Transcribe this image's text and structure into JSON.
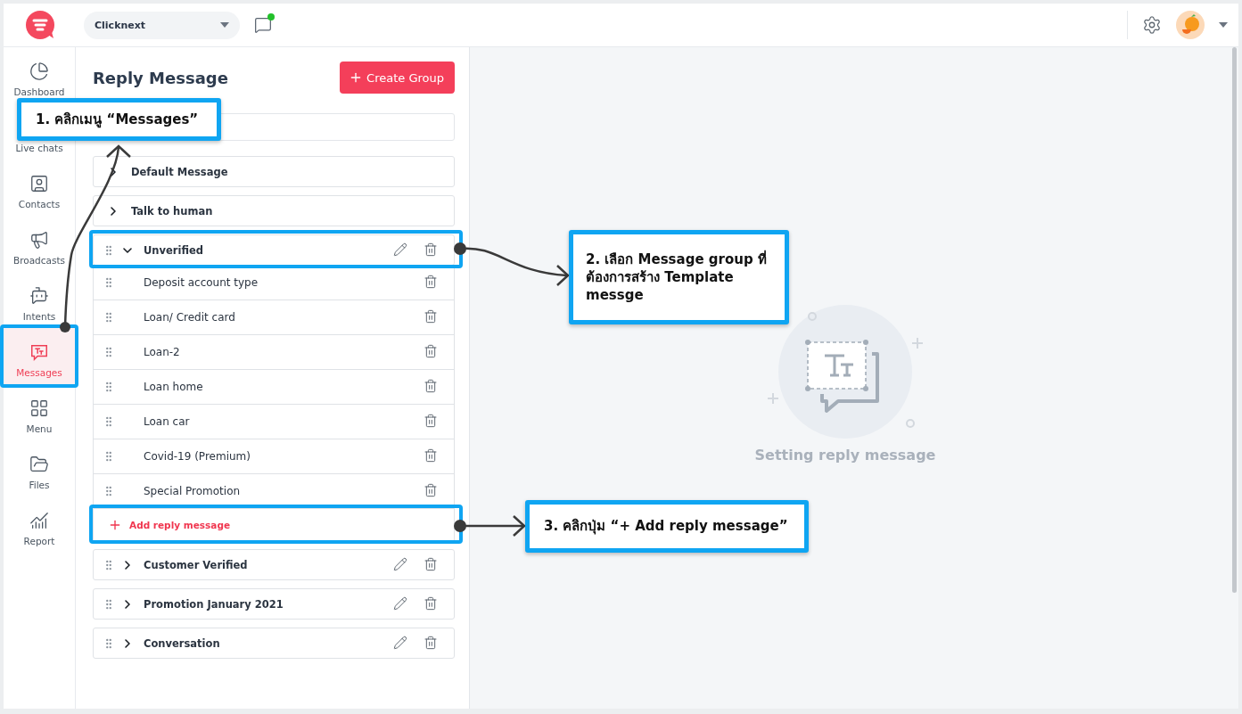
{
  "topbar": {
    "workspace": "Clicknext",
    "chat_online": true
  },
  "sidebar": {
    "items": [
      {
        "label": "Dashboard",
        "selected": false
      },
      {
        "label": "Live chats",
        "selected": false
      },
      {
        "label": "Contacts",
        "selected": false
      },
      {
        "label": "Broadcasts",
        "selected": false
      },
      {
        "label": "Intents",
        "selected": false
      },
      {
        "label": "Messages",
        "selected": true
      },
      {
        "label": "Menu",
        "selected": false
      },
      {
        "label": "Files",
        "selected": false
      },
      {
        "label": "Report",
        "selected": false
      }
    ]
  },
  "panel": {
    "title": "Reply Message",
    "create_button": "Create Group",
    "groups": [
      {
        "label": "Default Message",
        "kind": "fixed",
        "expanded": false
      },
      {
        "label": "Talk to human",
        "kind": "fixed",
        "expanded": false
      },
      {
        "label": "Unverified",
        "kind": "custom",
        "expanded": true,
        "add_label": "Add reply message",
        "messages": [
          {
            "label": "Deposit account type"
          },
          {
            "label": "Loan/ Credit card"
          },
          {
            "label": "Loan-2"
          },
          {
            "label": "Loan home"
          },
          {
            "label": "Loan car"
          },
          {
            "label": "Covid-19 (Premium)"
          },
          {
            "label": "Special Promotion"
          }
        ]
      },
      {
        "label": "Customer Verified",
        "kind": "custom",
        "expanded": false
      },
      {
        "label": "Promotion January 2021",
        "kind": "custom",
        "expanded": false
      },
      {
        "label": "Conversation",
        "kind": "custom",
        "expanded": false
      }
    ]
  },
  "empty_state": {
    "text": "Setting reply message"
  },
  "callouts": [
    {
      "text": "1. คลิกเมนู “Messages”"
    },
    {
      "text": "2. เลือก Message group ที่ต้องการสร้าง Template messge"
    },
    {
      "text": "3. คลิกปุ่ม “+ Add reply message”"
    }
  ]
}
